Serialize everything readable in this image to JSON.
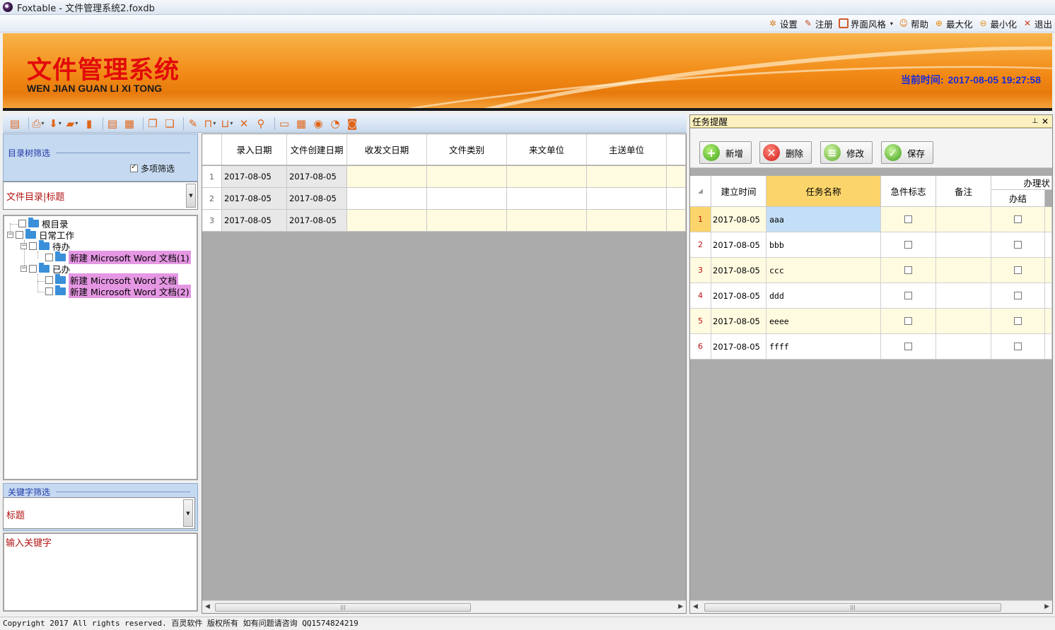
{
  "window": {
    "title": "Foxtable - 文件管理系统2.foxdb"
  },
  "menu": [
    {
      "label": "设置",
      "icon": "gear-icon"
    },
    {
      "label": "注册",
      "icon": "register-icon"
    },
    {
      "label": "界面风格",
      "icon": "style-icon"
    },
    {
      "label": "帮助",
      "icon": "help-icon"
    },
    {
      "label": "最大化",
      "icon": "zoom-in-icon"
    },
    {
      "label": "最小化",
      "icon": "zoom-out-icon"
    },
    {
      "label": "退出",
      "icon": "exit-icon"
    }
  ],
  "banner": {
    "title_cn": "文件管理系统",
    "title_en": "WEN JIAN GUAN LI XI TONG",
    "clock_label": "当前时间:",
    "clock_value": "2017-08-05 19:27:58"
  },
  "left": {
    "dir_filter_title": "目录树筛选",
    "multi_select_label": "多项筛选",
    "dir_combo_value": "文件目录|标题",
    "tree": {
      "root": "根目录",
      "daily": "日常工作",
      "todo": "待办",
      "todo_doc1": "新建 Microsoft Word 文档(1)",
      "done": "已办",
      "done_doc": "新建 Microsoft Word 文档",
      "done_doc2": "新建 Microsoft Word 文档(2)"
    },
    "kw_filter_title": "关键字筛选",
    "kw_combo_value": "标题",
    "kw_input_placeholder": "输入关键字"
  },
  "center_grid": {
    "columns": [
      "录入日期",
      "文件创建日期",
      "收发文日期",
      "文件类别",
      "来文单位",
      "主送单位"
    ],
    "rows": [
      {
        "n": "1",
        "entry": "2017-08-05",
        "created": "2017-08-05"
      },
      {
        "n": "2",
        "entry": "2017-08-05",
        "created": "2017-08-05"
      },
      {
        "n": "3",
        "entry": "2017-08-05",
        "created": "2017-08-05"
      }
    ]
  },
  "right": {
    "title": "任务提醒",
    "buttons": {
      "add": "新增",
      "delete": "删除",
      "edit": "修改",
      "save": "保存"
    },
    "columns": {
      "created": "建立时间",
      "name": "任务名称",
      "urgent": "急件标志",
      "note": "备注",
      "status_group": "办理状",
      "done": "办结"
    },
    "rows": [
      {
        "n": "1",
        "date": "2017-08-05",
        "name": "aaa"
      },
      {
        "n": "2",
        "date": "2017-08-05",
        "name": "bbb"
      },
      {
        "n": "3",
        "date": "2017-08-05",
        "name": "ccc"
      },
      {
        "n": "4",
        "date": "2017-08-05",
        "name": "ddd"
      },
      {
        "n": "5",
        "date": "2017-08-05",
        "name": "eeee"
      },
      {
        "n": "6",
        "date": "2017-08-05",
        "name": "ffff"
      }
    ]
  },
  "status": "Copyright 2017 All rights reserved. 百灵软件 版权所有 如有问题请咨询 QQ1574824219"
}
